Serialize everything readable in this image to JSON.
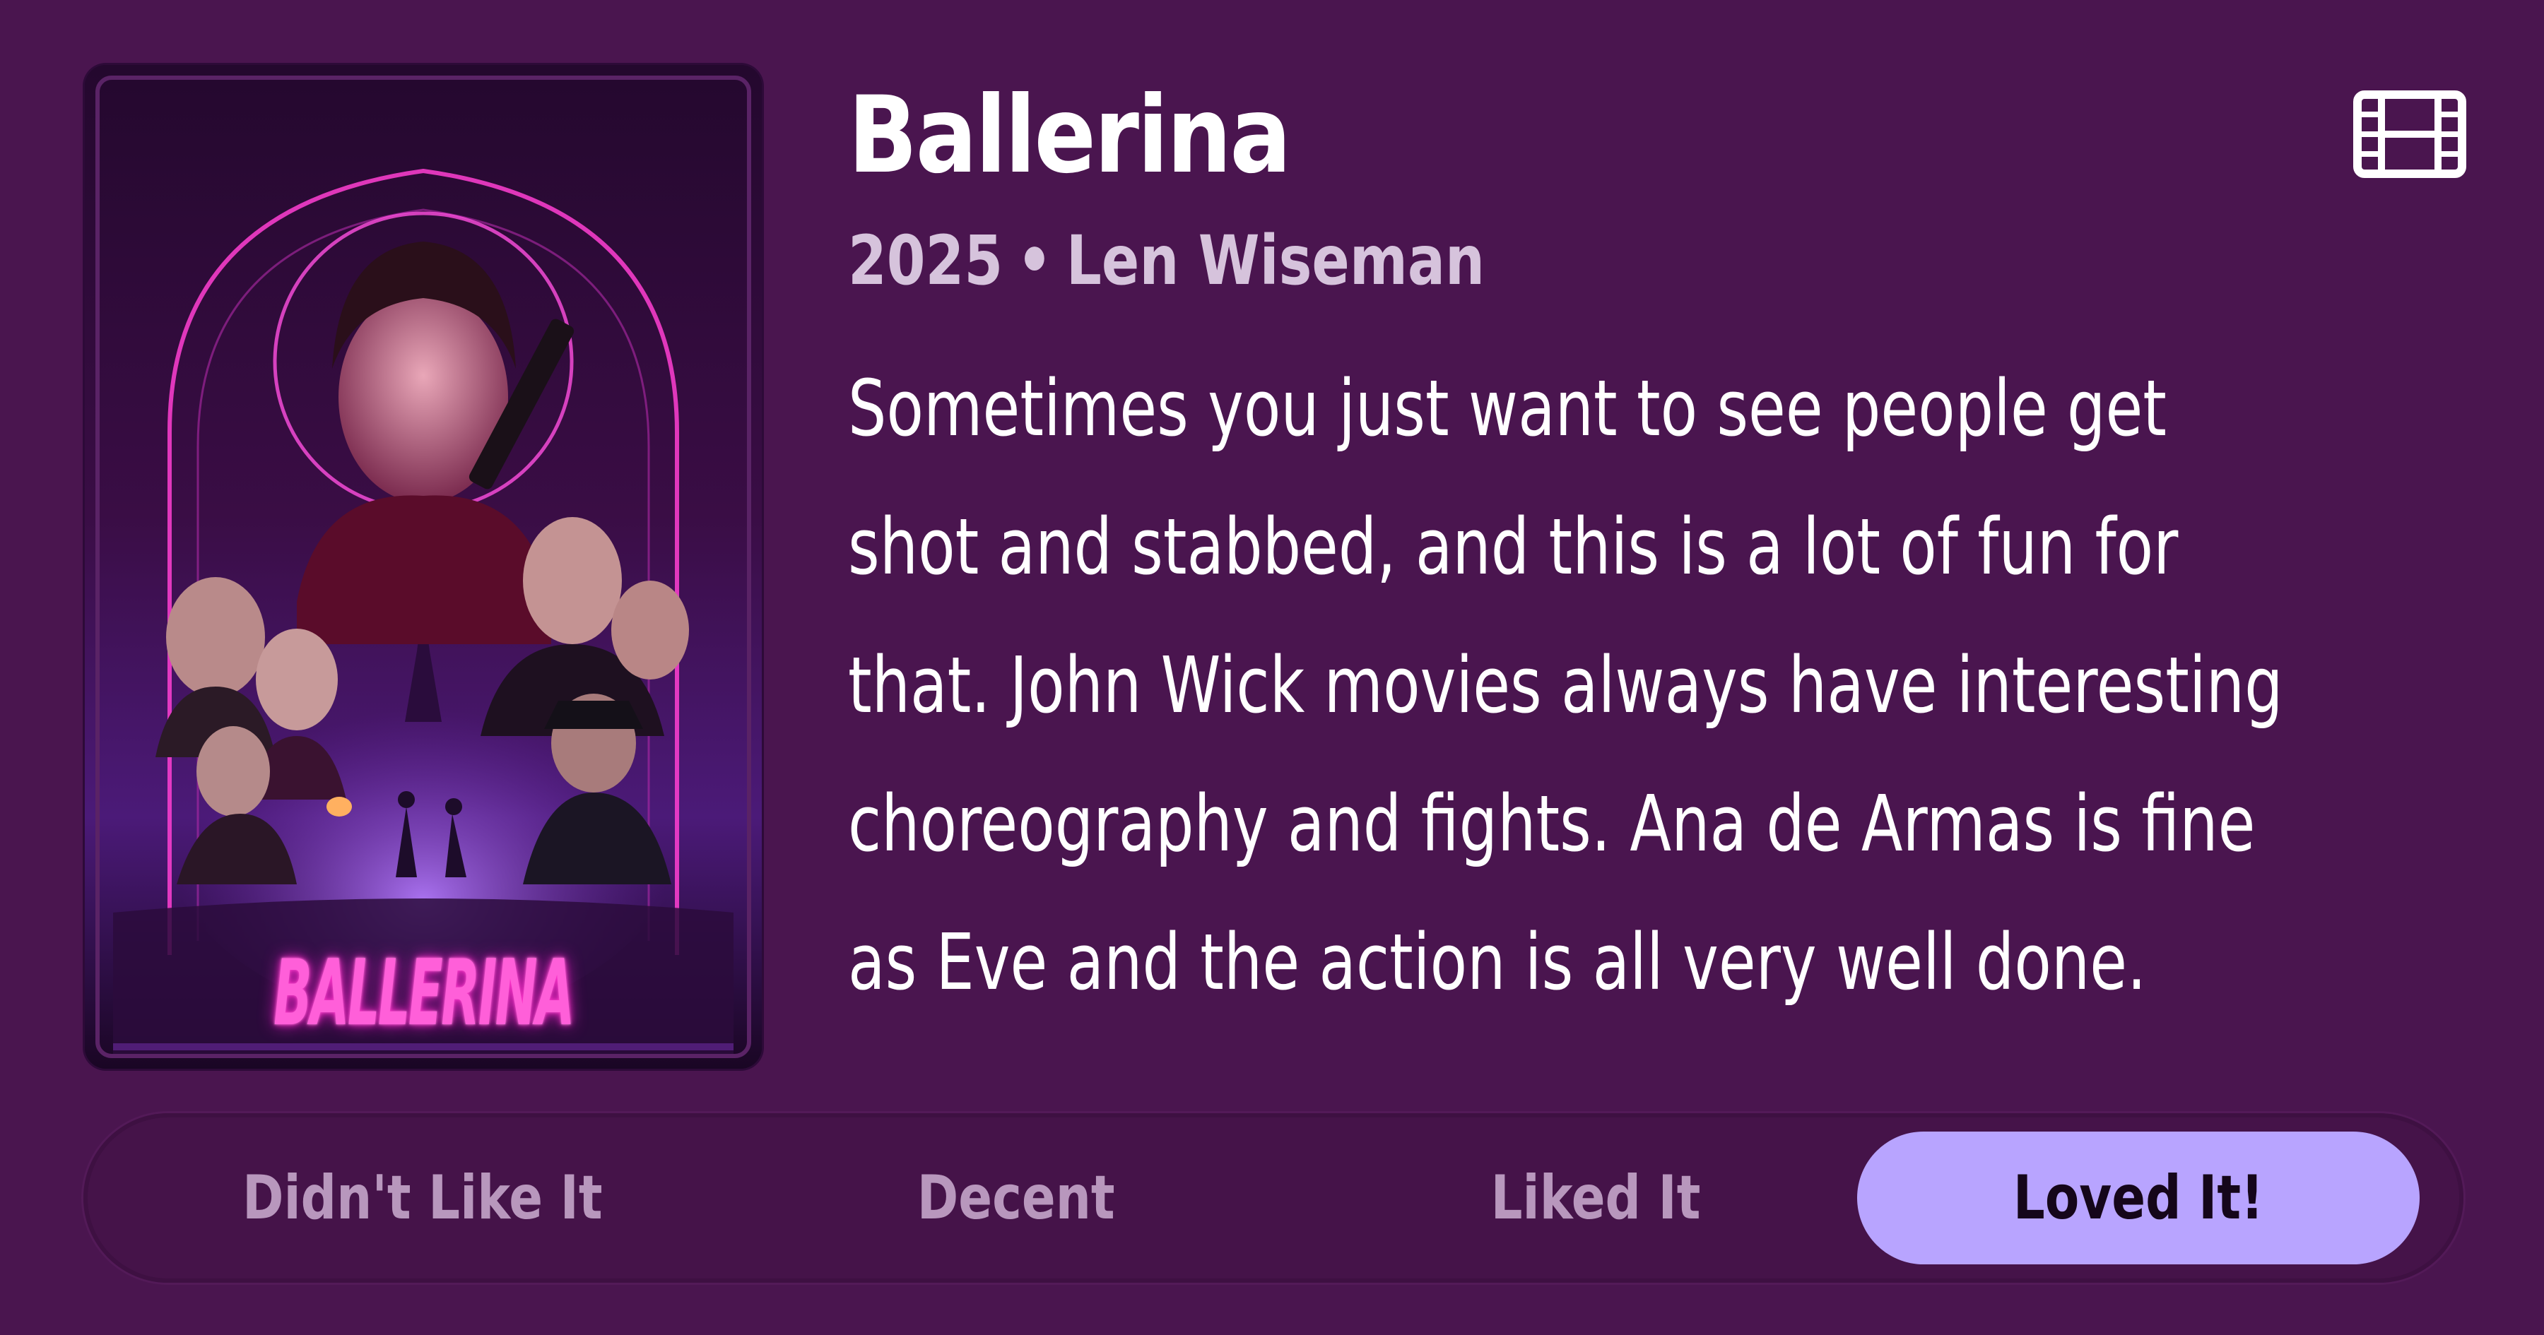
{
  "movie": {
    "title": "Ballerina",
    "year": "2025",
    "separator": "•",
    "director": "Len Wiseman",
    "type_icon": "film-icon",
    "poster_title": "BALLERINA"
  },
  "review": {
    "lines": [
      "Sometimes you just want to see people get",
      "shot and stabbed, and this is a lot of fun for",
      "that. John Wick movies always have interesting",
      "choreography and fights. Ana de Armas is fine",
      "as Eve and the action is all very well done."
    ]
  },
  "rating": {
    "options": [
      {
        "label": "Didn't Like It",
        "selected": false
      },
      {
        "label": "Decent",
        "selected": false
      },
      {
        "label": "Liked It",
        "selected": false
      },
      {
        "label": "Loved It!",
        "selected": true
      }
    ]
  },
  "colors": {
    "background": "#4a154f",
    "selected_option": "#b8a4ff",
    "muted_text": "#b897bd",
    "meta_text": "#d6c3dc"
  }
}
